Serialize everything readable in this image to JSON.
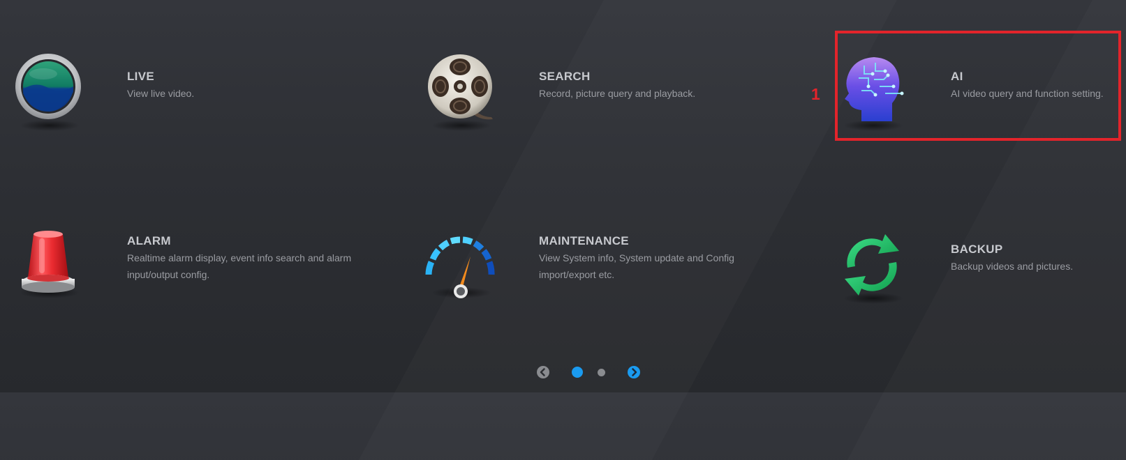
{
  "menu": {
    "live": {
      "title": "LIVE",
      "description": "View live video.",
      "icon": "monitor-icon"
    },
    "search": {
      "title": "SEARCH",
      "description": "Record, picture query and playback.",
      "icon": "film-reel-icon"
    },
    "ai": {
      "title": "AI",
      "description": "AI video query and function setting.",
      "icon": "ai-head-icon"
    },
    "alarm": {
      "title": "ALARM",
      "description": "Realtime alarm display, event info search and alarm input/output config.",
      "icon": "siren-icon"
    },
    "maintenance": {
      "title": "MAINTENANCE",
      "description": "View System info, System update and Config import/export etc.",
      "icon": "gauge-icon"
    },
    "backup": {
      "title": "BACKUP",
      "description": "Backup videos and pictures.",
      "icon": "sync-arrows-icon"
    }
  },
  "annotation": {
    "label": "1",
    "color": "#e3242b"
  },
  "pagination": {
    "pages": 2,
    "current_page": 1,
    "active_color": "#1a9bf0",
    "inactive_color": "#8a8c90"
  },
  "colors": {
    "background": "#2d2f34",
    "title_text": "#c7c9ce",
    "description_text": "#9a9ca2"
  }
}
